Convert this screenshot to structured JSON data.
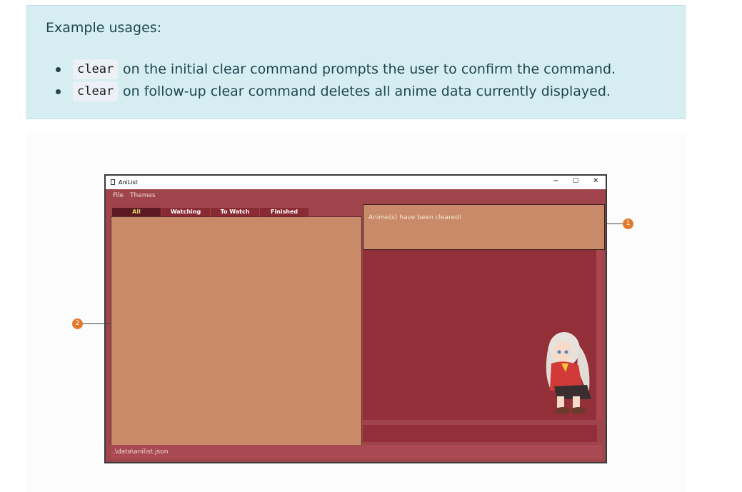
{
  "callout": {
    "title": "Example usages:",
    "items": [
      {
        "code": "clear",
        "text": "on the initial clear command prompts the user to confirm the command."
      },
      {
        "code": "clear",
        "text": "on follow-up clear command deletes all anime data currently displayed."
      }
    ]
  },
  "app": {
    "title": "AniList",
    "menu": [
      "File",
      "Themes"
    ],
    "tabs": [
      "All",
      "Watching",
      "To Watch",
      "Finished"
    ],
    "active_tab": "All",
    "result_message": "Anime(s) have been cleared!",
    "status_path": ".\\data\\anilist.json",
    "window_controls": {
      "minimize": "−",
      "maximize": "☐",
      "close": "✕"
    }
  },
  "annotations": [
    "1",
    "2"
  ],
  "colors": {
    "callout_bg": "#d6edf2",
    "app_bg": "#a0444c",
    "panel": "#c88a68",
    "marker": "#e07a2e"
  }
}
